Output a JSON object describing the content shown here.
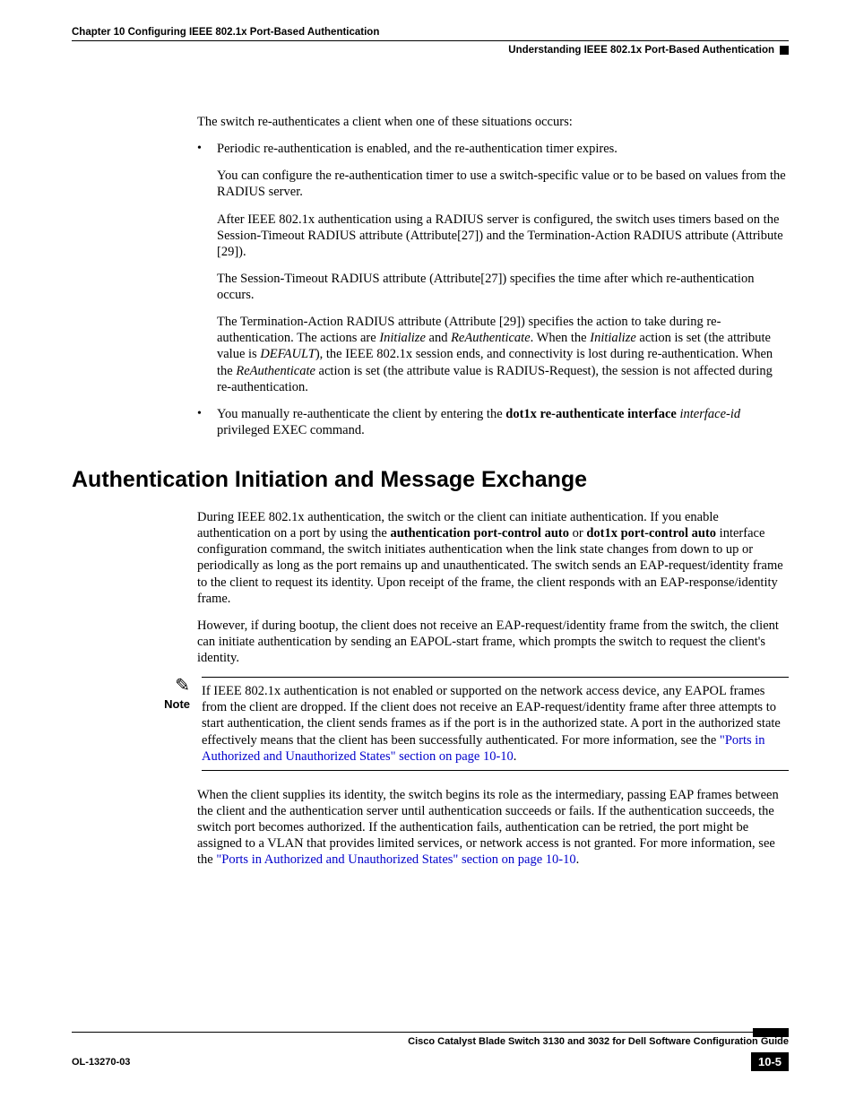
{
  "header": {
    "chapter": "Chapter 10      Configuring IEEE 802.1x Port-Based Authentication",
    "section": "Understanding IEEE 802.1x Port-Based Authentication"
  },
  "content": {
    "p1": "The switch re-authenticates a client when one of these situations occurs:",
    "b1": "Periodic re-authentication is enabled, and the re-authentication timer expires.",
    "b1a": "You can configure the re-authentication timer to use a switch-specific value or to be based on values from the RADIUS server.",
    "b1b": "After IEEE 802.1x authentication using a RADIUS server is configured, the switch uses timers based on the Session-Timeout RADIUS attribute (Attribute[27]) and the Termination-Action RADIUS attribute (Attribute [29]).",
    "b1c": "The Session-Timeout RADIUS attribute (Attribute[27]) specifies the time after which re-authentication occurs.",
    "b1d_pre": "The Termination-Action RADIUS attribute (Attribute [29]) specifies the action to take during re-authentication. The actions are ",
    "b1d_i1": "Initialize",
    "b1d_mid1": " and ",
    "b1d_i2": "ReAuthenticate",
    "b1d_mid2": ". When the ",
    "b1d_i3": "Initialize",
    "b1d_mid3": " action is set (the attribute value is ",
    "b1d_i4": "DEFAULT",
    "b1d_mid4": "), the IEEE 802.1x session ends, and connectivity is lost during re-authentication. When the ",
    "b1d_i5": "ReAuthenticate",
    "b1d_post": " action is set (the attribute value is RADIUS-Request), the session is not affected during re-authentication.",
    "b2_pre": "You manually re-authenticate the client by entering the ",
    "b2_bold": "dot1x re-authenticate interface",
    "b2_i": "interface-id",
    "b2_post": " privileged EXEC command.",
    "h2": "Authentication Initiation and Message Exchange",
    "p2_pre": "During IEEE 802.1x authentication, the switch or the client can initiate authentication. If you enable authentication on a port by using the ",
    "p2_b1": "authentication port-control auto",
    "p2_mid": " or ",
    "p2_b2": "dot1x port-control auto",
    "p2_post": " interface configuration command, the switch initiates authentication when the link state changes from down to up or periodically as long as the port remains up and unauthenticated. The switch sends an EAP-request/identity frame to the client to request its identity. Upon receipt of the frame, the client responds with an EAP-response/identity frame.",
    "p3": "However, if during bootup, the client does not receive an EAP-request/identity frame from the switch, the client can initiate authentication by sending an EAPOL-start frame, which prompts the switch to request the client's identity.",
    "note_label": "Note",
    "note_pre": "If IEEE 802.1x authentication is not enabled or supported on the network access device, any EAPOL frames from the client are dropped. If the client does not receive an EAP-request/identity frame after three attempts to start authentication, the client sends frames as if the port is in the authorized state. A port in the authorized state effectively means that the client has been successfully authenticated. For more information, see the ",
    "note_link": "\"Ports in Authorized and Unauthorized States\" section on page 10-10",
    "note_post": ".",
    "p4_pre": "When the client supplies its identity, the switch begins its role as the intermediary, passing EAP frames between the client and the authentication server until authentication succeeds or fails. If the authentication succeeds, the switch port becomes authorized. If the authentication fails, authentication can be retried, the port might be assigned to a VLAN that provides limited services, or network access is not granted. For more information, see the ",
    "p4_link": "\"Ports in Authorized and Unauthorized States\" section on page 10-10",
    "p4_post": "."
  },
  "footer": {
    "guide": "Cisco Catalyst Blade Switch 3130 and 3032 for Dell Software Configuration Guide",
    "docid": "OL-13270-03",
    "pagenum": "10-5"
  }
}
